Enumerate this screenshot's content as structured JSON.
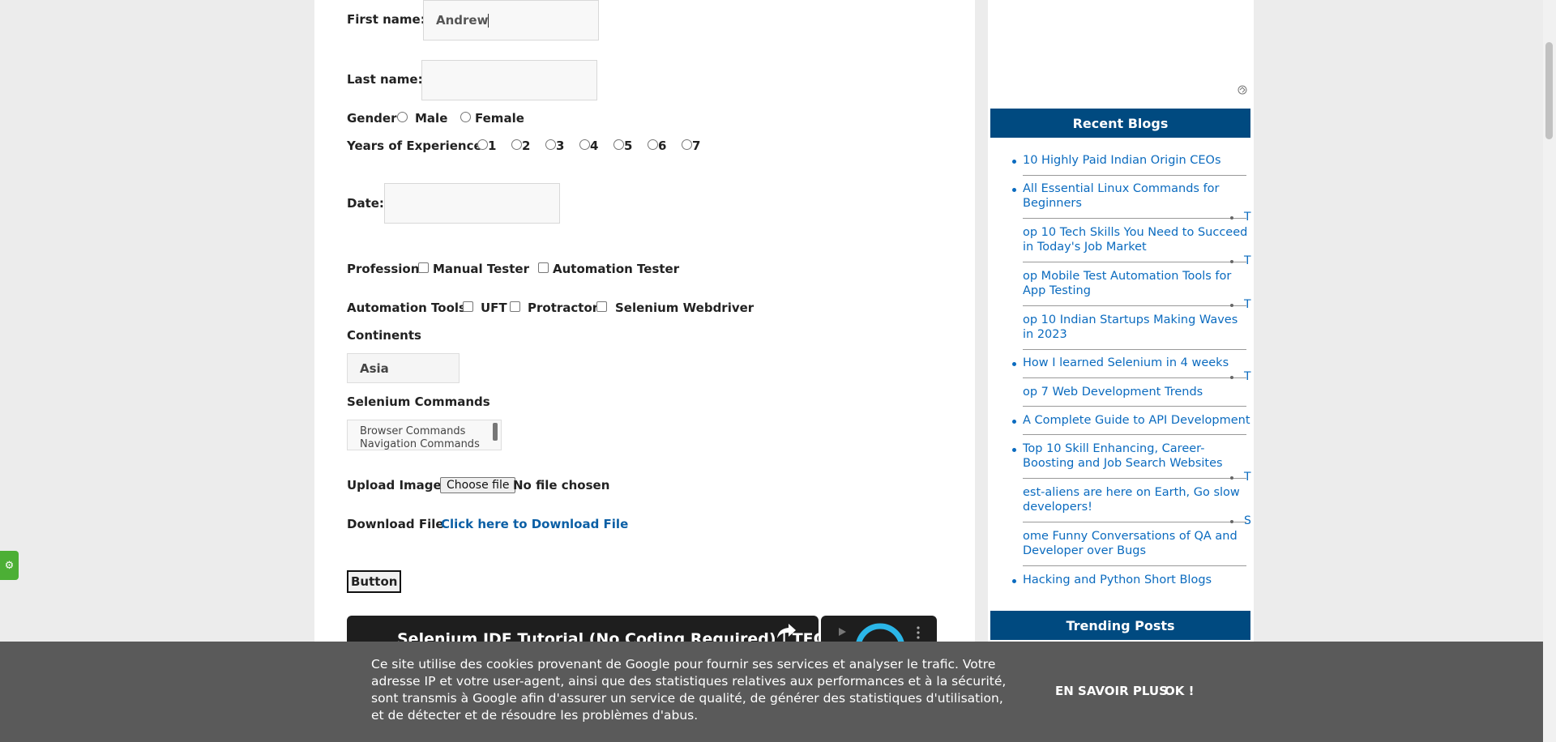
{
  "form": {
    "first_name_label": "First name:",
    "first_name_value": "Andrew",
    "last_name_label": "Last name:",
    "last_name_value": "",
    "gender_label": "Gender",
    "gender_male": "Male",
    "gender_female": "Female",
    "experience_label": "Years of Experience",
    "experience_options": [
      "1",
      "2",
      "3",
      "4",
      "5",
      "6",
      "7"
    ],
    "date_label": "Date:",
    "date_value": "",
    "profession_label": "Profession",
    "profession_manual": "Manual Tester",
    "profession_auto": "Automation Tester",
    "tools_label": "Automation Tools",
    "tool_uft": "UFT",
    "tool_protractor": "Protractor",
    "tool_selenium": "Selenium Webdriver",
    "continents_label": "Continents",
    "continents_value": "Asia",
    "commands_label": "Selenium Commands",
    "commands_options": [
      "Browser Commands",
      "Navigation Commands"
    ],
    "upload_label": "Upload Image",
    "upload_button": "Choose file",
    "upload_status": "No file chosen",
    "download_label": "Download File",
    "download_link": "Click here to Download File",
    "button_label": "Button"
  },
  "video": {
    "title": "Selenium IDE Tutorial (No Coding Required) | TEC"
  },
  "sidebar": {
    "recent_blogs_title": "Recent Blogs",
    "blogs": [
      "10 Highly Paid Indian Origin CEOs",
      "All Essential Linux Commands for Beginners",
      "op 10 Tech Skills You Need to Succeed in Today's Job Market",
      "op Mobile Test Automation Tools for App Testing",
      "op 10 Indian Startups Making Waves in 2023",
      "How I learned Selenium in 4 weeks",
      "op 7 Web Development Trends",
      "A Complete Guide to API Development",
      "Top 10 Skill Enhancing, Career-Boosting and Job Search Websites",
      "est-aliens are here on Earth, Go slow developers!",
      "ome Funny Conversations of QA and Developer over Bugs",
      "Hacking and Python Short Blogs"
    ],
    "overflow_chars": [
      "T",
      "T",
      "T",
      "T",
      "T",
      "S"
    ],
    "trending_title": "Trending Posts"
  },
  "cookie": {
    "text": "Ce site utilise des cookies provenant de Google pour fournir ses services et analyser le trafic. Votre adresse IP et votre user-agent, ainsi que des statistiques relatives aux performances et à la sécurité, sont transmis à Google afin d'assurer un service de qualité, de générer des statistiques d'utilisation, et de détecter et de résoudre les problèmes d'abus.",
    "learn_more": "EN SAVOIR PLUS",
    "ok": "OK !"
  },
  "colors": {
    "link": "#0b5fa5",
    "widget_header": "#004a80",
    "cookie_bg": "#5a5a5a",
    "gear_tab": "#4caf35"
  }
}
